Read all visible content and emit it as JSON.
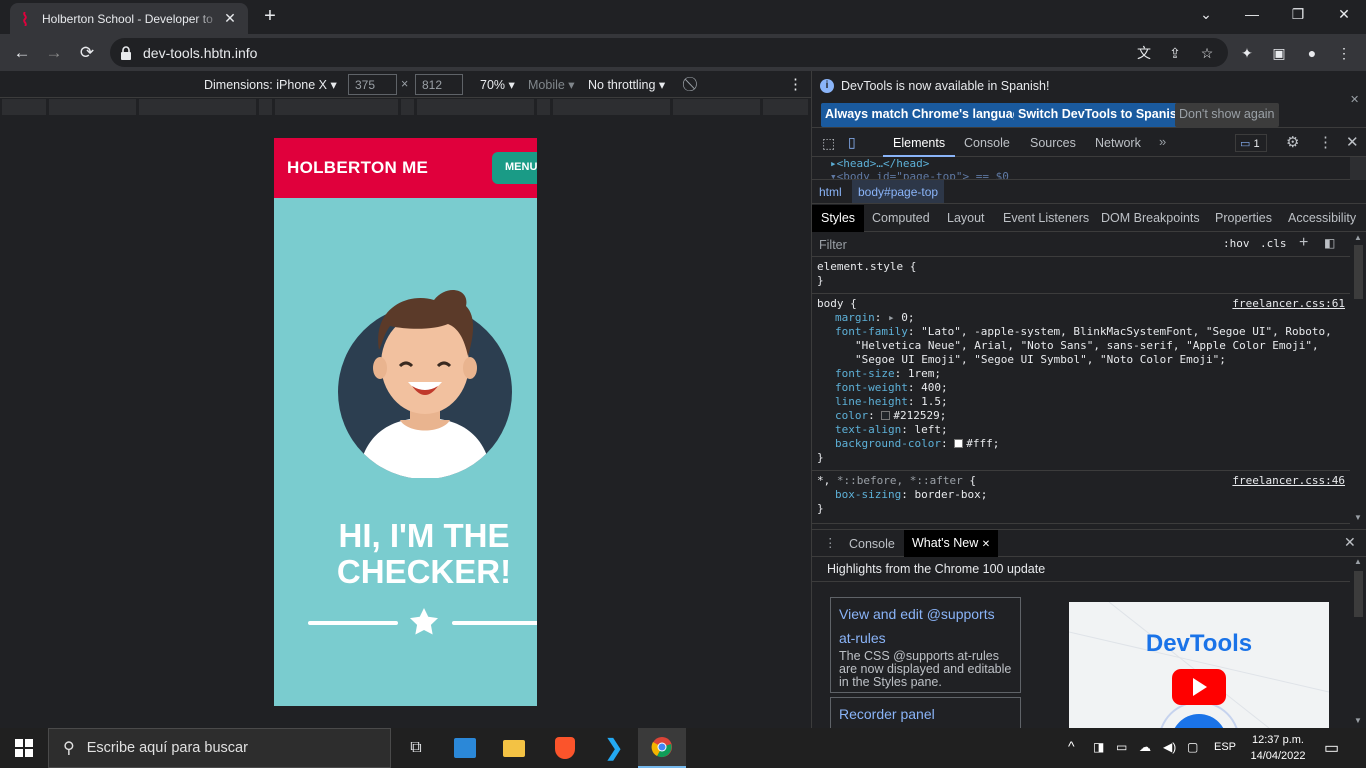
{
  "browser": {
    "tab_title": "Holberton School - Developer to",
    "address": "dev-tools.hbtn.info"
  },
  "device_toolbar": {
    "dimensions_label": "Dimensions: iPhone X",
    "width": "375",
    "times": "×",
    "height": "812",
    "zoom": "70%",
    "mobile": "Mobile",
    "throttling": "No throttling"
  },
  "page": {
    "brand": "HOLBERTON ME",
    "menu_button": "MENU",
    "hero_line1": "HI, I'M THE",
    "hero_line2": "CHECKER!"
  },
  "devtools": {
    "infobar_message": "DevTools is now available in Spanish!",
    "btn_match": "Always match Chrome's language",
    "btn_switch": "Switch DevTools to Spanish",
    "btn_dont": "Don't show again",
    "tabs": [
      "Elements",
      "Console",
      "Sources",
      "Network"
    ],
    "issues_count": "1",
    "dom_line1": "<head>…</head>",
    "dom_line2": "<body id=\"page-top\"> == $0",
    "breadcrumb_html": "html",
    "breadcrumb_body": "body#page-top",
    "style_tabs": [
      "Styles",
      "Computed",
      "Layout",
      "Event Listeners",
      "DOM Breakpoints",
      "Properties",
      "Accessibility"
    ],
    "filter_placeholder": "Filter",
    "hov": ":hov",
    "cls": ".cls",
    "element_style": "element.style {",
    "close_brace": "}",
    "body_selector": "body {",
    "body_source": "freelancer.css:61",
    "body_props": [
      {
        "name": "margin",
        "value": "0;"
      },
      {
        "name": "font-family",
        "value": "\"Lato\", -apple-system, BlinkMacSystemFont, \"Segoe UI\", Roboto,"
      },
      {
        "name": "",
        "value": "\"Helvetica Neue\", Arial, \"Noto Sans\", sans-serif, \"Apple Color Emoji\","
      },
      {
        "name": "",
        "value": "\"Segoe UI Emoji\", \"Segoe UI Symbol\", \"Noto Color Emoji\";"
      },
      {
        "name": "font-size",
        "value": "1rem;"
      },
      {
        "name": "font-weight",
        "value": "400;"
      },
      {
        "name": "line-height",
        "value": "1.5;"
      },
      {
        "name": "color",
        "value": "#212529;"
      },
      {
        "name": "text-align",
        "value": "left;"
      },
      {
        "name": "background-color",
        "value": "#fff;"
      }
    ],
    "star_selector_main": "*,",
    "star_selector_pseudo": "*::before, *::after",
    "star_source": "freelancer.css:46",
    "star_prop_name": "box-sizing",
    "star_prop_value": "border-box;",
    "drawer_tab_console": "Console",
    "drawer_tab_whatsnew": "What's New",
    "drawer_heading": "Highlights from the Chrome 100 update",
    "card1_link1": "View and edit @supports",
    "card1_link2": "at-rules",
    "card1_desc": "The CSS @supports at-rules are now displayed and editable in the Styles pane.",
    "card2_link": "Recorder panel",
    "promo_title": "DevTools"
  },
  "taskbar": {
    "search_placeholder": "Escribe aquí para buscar",
    "language": "ESP",
    "time": "12:37 p.m.",
    "date": "14/04/2022"
  },
  "colors": {
    "page_nav": "#e0003c",
    "page_bg": "#7acccf",
    "menu_btn": "#1a9b86",
    "devtools_accent": "#8ab4f8",
    "swatch_color": "#212529",
    "swatch_bg": "#ffffff"
  }
}
